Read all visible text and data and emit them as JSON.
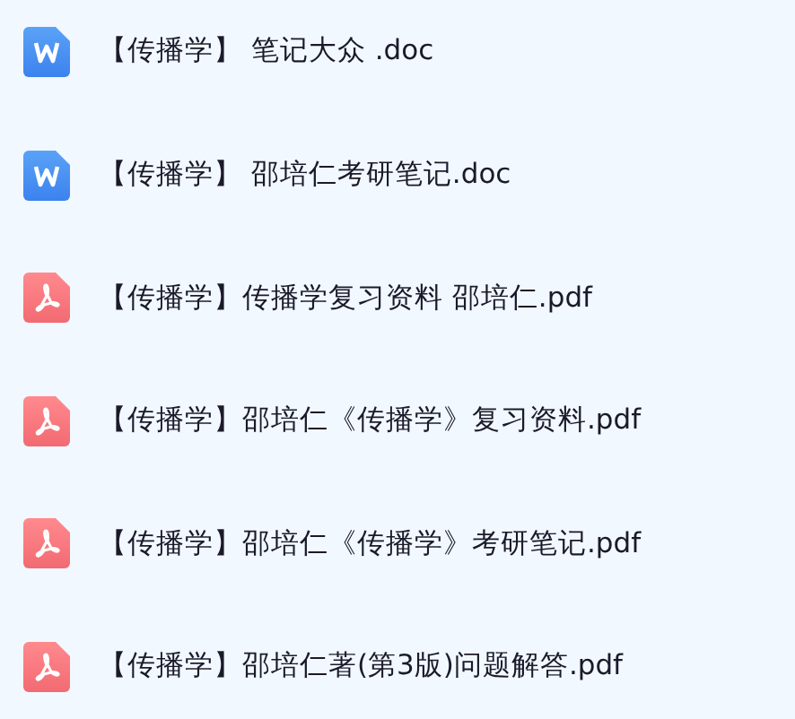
{
  "files": [
    {
      "kind": "word",
      "name": "【传播学】 笔记大众 .doc"
    },
    {
      "kind": "word",
      "name": "【传播学】 邵培仁考研笔记.doc"
    },
    {
      "kind": "pdf",
      "name": "【传播学】传播学复习资料 邵培仁.pdf"
    },
    {
      "kind": "pdf",
      "name": "【传播学】邵培仁《传播学》复习资料.pdf"
    },
    {
      "kind": "pdf",
      "name": "【传播学】邵培仁《传播学》考研笔记.pdf"
    },
    {
      "kind": "pdf",
      "name": "【传播学】邵培仁著(第3版)问题解答.pdf"
    }
  ]
}
